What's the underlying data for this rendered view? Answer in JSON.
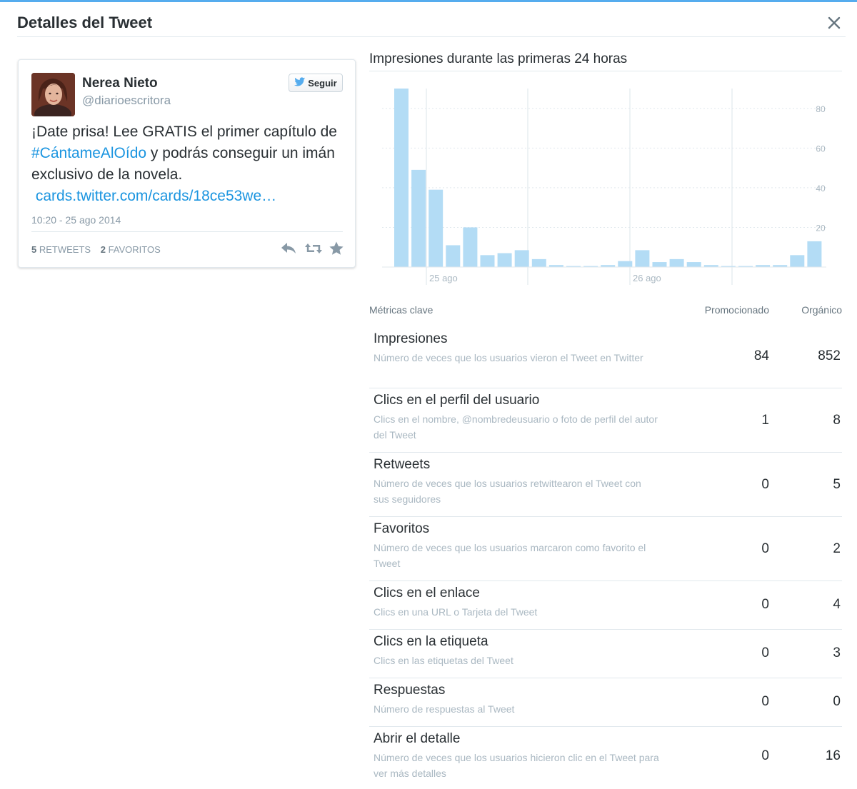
{
  "modal": {
    "title": "Detalles del Tweet",
    "close_icon": "close-icon"
  },
  "tweet": {
    "user_name": "Nerea Nieto",
    "user_handle": "@diarioescritora",
    "follow_label": "Seguir",
    "text_part1": "¡Date prisa! Lee GRATIS el primer capítulo de ",
    "hashtag": "#CántameAlOído",
    "text_part2": " y podrás conseguir un imán exclusivo de la novela.",
    "link": "cards.twitter.com/cards/18ce53we…",
    "timestamp": "10:20 - 25 ago 2014",
    "retweets_count": "5",
    "retweets_label": "RETWEETS",
    "favorites_count": "2",
    "favorites_label": "FAVORITOS",
    "actions": [
      "reply-icon",
      "retweet-icon",
      "favorite-icon"
    ],
    "accent_color": "#1b95e0"
  },
  "chart": {
    "title": "Impresiones durante las primeras 24 horas"
  },
  "chart_data": {
    "type": "bar",
    "title": "Impresiones durante las primeras 24 horas",
    "x_tick_labels": [
      "25 ago",
      "26 ago"
    ],
    "y_ticks": [
      20,
      40,
      60,
      80
    ],
    "ylim": [
      0,
      90
    ],
    "values": [
      90,
      49,
      39,
      11,
      20,
      6,
      7,
      8.5,
      4,
      1,
      0.5,
      0.5,
      1,
      3,
      8.5,
      2.5,
      4,
      2.5,
      1,
      0.5,
      0.5,
      1,
      1,
      6,
      13
    ],
    "bar_color": "#b3dcf5",
    "grid": true
  },
  "metrics": {
    "header_label": "Métricas clave",
    "header_promoted": "Promocionado",
    "header_organic": "Orgánico",
    "rows": [
      {
        "name": "Impresiones",
        "desc": "Número de veces que los usuarios vieron el Tweet en Twitter",
        "promoted": "84",
        "organic": "852"
      },
      {
        "name": "Clics en el perfil del usuario",
        "desc": "Clics en el nombre, @nombredeusuario o foto de perfil del autor del Tweet",
        "promoted": "1",
        "organic": "8"
      },
      {
        "name": "Retweets",
        "desc": "Número de veces que los usuarios retwittearon el Tweet con sus seguidores",
        "promoted": "0",
        "organic": "5"
      },
      {
        "name": "Favoritos",
        "desc": "Número de veces que los usuarios marcaron como favorito el Tweet",
        "promoted": "0",
        "organic": "2"
      },
      {
        "name": "Clics en el enlace",
        "desc": "Clics en una URL o Tarjeta del Tweet",
        "promoted": "0",
        "organic": "4"
      },
      {
        "name": "Clics en la etiqueta",
        "desc": "Clics en las etiquetas del Tweet",
        "promoted": "0",
        "organic": "3"
      },
      {
        "name": "Respuestas",
        "desc": "Número de respuestas al Tweet",
        "promoted": "0",
        "organic": "0"
      },
      {
        "name": "Abrir el detalle",
        "desc": "Número de veces que los usuarios hicieron clic en el Tweet para ver más detalles",
        "promoted": "0",
        "organic": "16"
      }
    ]
  }
}
